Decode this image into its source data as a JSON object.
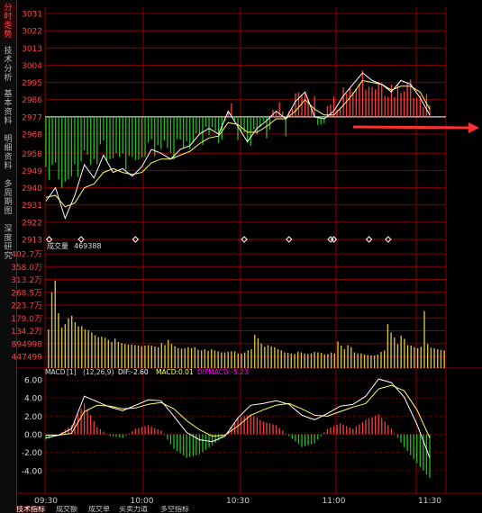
{
  "sidebar": {
    "tabs": [
      {
        "label": "分时走势",
        "active": true
      },
      {
        "label": "技术分析",
        "active": false
      },
      {
        "label": "基本资料",
        "active": false
      },
      {
        "label": "明细资料",
        "active": false
      },
      {
        "label": "多周期图",
        "active": false
      },
      {
        "label": "深度研究",
        "active": false
      }
    ]
  },
  "bottom_tabs": [
    "技术指标",
    "成交额",
    "成交单",
    "买卖力道",
    "多空指标"
  ],
  "colors": {
    "up": "#ff3c3c",
    "down": "#20c020",
    "price": "#ffffff",
    "avg": "#ffff60",
    "grid": "#8a0000",
    "label": "#ff4040",
    "vol": "#d4c040",
    "dif": "#ffffff",
    "dea": "#ffff60",
    "macd_label": "#ff00ff",
    "arrow": "#ff3030"
  },
  "chart_data": [
    {
      "type": "line",
      "panel": "price",
      "y_ticks": [
        "3031",
        "3022",
        "3013",
        "3004",
        "2995",
        "2986",
        "2977",
        "2968",
        "2958",
        "2949",
        "2940",
        "2931",
        "2922",
        "2913"
      ],
      "ylim": [
        2913,
        3031
      ],
      "reference": 2977,
      "x_ticks": [
        "09:30",
        "10:00",
        "10:30",
        "11:00",
        "11:30"
      ],
      "minutes": 120,
      "series": [
        {
          "key": "price",
          "x": [
            0,
            3,
            6,
            9,
            12,
            15,
            18,
            21,
            24,
            27,
            30,
            33,
            36,
            39,
            42,
            45,
            48,
            51,
            54,
            57,
            60,
            63,
            66,
            69,
            72,
            75,
            78,
            81,
            84,
            87,
            90,
            93,
            96,
            99,
            102,
            105,
            108,
            111,
            114,
            117,
            120
          ],
          "values": [
            2933,
            2940,
            2924,
            2936,
            2952,
            2945,
            2957,
            2948,
            2950,
            2946,
            2951,
            2960,
            2958,
            2955,
            2960,
            2962,
            2968,
            2971,
            2968,
            2980,
            2972,
            2964,
            2971,
            2975,
            2980,
            2976,
            2985,
            2990,
            2977,
            2976,
            2980,
            2988,
            2994,
            3000,
            2996,
            2994,
            2990,
            2996,
            2994,
            2987,
            2978
          ]
        },
        {
          "key": "avg",
          "x": [
            0,
            3,
            6,
            9,
            12,
            15,
            18,
            21,
            24,
            27,
            30,
            33,
            36,
            39,
            42,
            45,
            48,
            51,
            54,
            57,
            60,
            63,
            66,
            69,
            72,
            75,
            78,
            81,
            84,
            87,
            90,
            93,
            96,
            99,
            102,
            105,
            108,
            111,
            114,
            117,
            120
          ],
          "values": [
            2935,
            2936,
            2930,
            2932,
            2940,
            2942,
            2948,
            2950,
            2948,
            2947,
            2948,
            2953,
            2955,
            2955,
            2957,
            2959,
            2963,
            2966,
            2967,
            2974,
            2973,
            2969,
            2969,
            2972,
            2976,
            2976,
            2980,
            2986,
            2981,
            2978,
            2978,
            2983,
            2989,
            2996,
            2995,
            2994,
            2991,
            2993,
            2993,
            2990,
            2981
          ]
        }
      ],
      "markers_minutes": [
        1,
        11,
        28,
        62,
        76,
        89,
        90,
        101,
        107
      ]
    },
    {
      "type": "bar",
      "panel": "volume",
      "title": "成交量",
      "value_label": "469388",
      "y_ticks": [
        "402.7万",
        "358.0万",
        "313.2万",
        "268.5万",
        "223.7万",
        "179.0万",
        "134.2万",
        "894998",
        "447499"
      ],
      "ylim": [
        0,
        4474990
      ],
      "values": [
        1480000,
        2900000,
        3350000,
        2100000,
        1550000,
        1680000,
        1900000,
        2000000,
        1760000,
        1600000,
        1600000,
        1480000,
        1450000,
        1360000,
        1260000,
        1180000,
        1200000,
        1160000,
        1080000,
        1000000,
        1130000,
        1000000,
        960000,
        920000,
        900000,
        900000,
        880000,
        870000,
        840000,
        860000,
        880000,
        860000,
        830000,
        800000,
        960000,
        880000,
        1080000,
        920000,
        840000,
        770000,
        740000,
        760000,
        800000,
        770000,
        800000,
        700000,
        680000,
        720000,
        660000,
        720000,
        680000,
        640000,
        600000,
        600000,
        620000,
        640000,
        640000,
        560000,
        560000,
        600000,
        680000,
        720000,
        1280000,
        1140000,
        940000,
        820000,
        880000,
        830000,
        800000,
        720000,
        680000,
        600000,
        580000,
        560000,
        540000,
        620000,
        600000,
        560000,
        540000,
        560000,
        620000,
        600000,
        580000,
        520000,
        540000,
        600000,
        560000,
        1020000,
        860000,
        720000,
        880000,
        800000,
        600000,
        560000,
        560000,
        520000,
        500000,
        480000,
        480000,
        520000,
        620000,
        680000,
        1680000,
        1360000,
        1170000,
        920000,
        1240000,
        1120000,
        880000,
        860000,
        800000,
        760000,
        820000,
        2180000,
        920000,
        780000,
        760000,
        720000,
        700000,
        680000
      ]
    },
    {
      "type": "bar",
      "panel": "macd",
      "title": "MACD",
      "params": "[1]",
      "param_values": "(12,26,9)",
      "dif_label": "DIF:-2.60",
      "macd_label": "MACD:0.01",
      "difmacd_label": "DIFMACD:-5.23",
      "y_ticks": [
        "6.00",
        "4.00",
        "2.00",
        "0.00",
        "-2.00",
        "-4.00"
      ],
      "ylim": [
        -6.2,
        7.2
      ],
      "x": [
        0,
        4,
        8,
        12,
        16,
        20,
        24,
        28,
        32,
        36,
        40,
        44,
        48,
        52,
        56,
        60,
        64,
        68,
        72,
        76,
        80,
        84,
        88,
        92,
        96,
        100,
        104,
        108,
        112,
        116,
        120
      ],
      "series": [
        {
          "key": "dif",
          "values": [
            -0.4,
            -0.1,
            0.6,
            4.2,
            3.6,
            3.0,
            2.6,
            3.2,
            3.8,
            3.7,
            2.0,
            0.2,
            -0.6,
            -0.8,
            -0.2,
            1.8,
            3.2,
            3.4,
            3.7,
            3.3,
            2.1,
            1.6,
            2.3,
            3.1,
            3.3,
            4.2,
            6.1,
            5.7,
            4.1,
            1.1,
            -2.6
          ]
        },
        {
          "key": "dea",
          "values": [
            -0.1,
            -0.1,
            0.1,
            2.5,
            3.2,
            3.1,
            2.8,
            2.9,
            3.3,
            3.5,
            2.8,
            1.5,
            0.5,
            -0.2,
            -0.1,
            0.9,
            2.1,
            2.7,
            3.2,
            3.4,
            2.8,
            2.1,
            2.0,
            2.5,
            3.0,
            3.4,
            5.0,
            5.4,
            4.8,
            2.7,
            -0.4
          ]
        },
        {
          "key": "macd",
          "values": [
            -0.6,
            0.0,
            1.0,
            3.4,
            0.8,
            -0.2,
            -0.4,
            0.6,
            1.0,
            0.4,
            -1.6,
            -2.6,
            -2.2,
            -1.2,
            -0.2,
            1.8,
            2.2,
            1.4,
            1.0,
            -0.2,
            -1.4,
            -1.0,
            0.6,
            1.2,
            0.6,
            1.6,
            2.2,
            0.6,
            -1.4,
            -3.2,
            -4.8
          ]
        }
      ]
    }
  ]
}
